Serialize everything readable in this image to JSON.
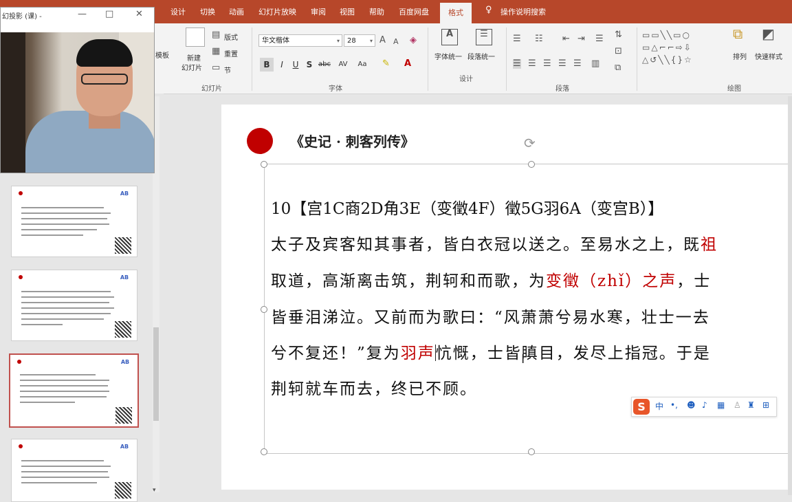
{
  "ribbon_tabs": [
    "设计",
    "切换",
    "动画",
    "幻灯片放映",
    "审阅",
    "视图",
    "帮助",
    "百度网盘",
    "格式"
  ],
  "tell_me": "操作说明搜索",
  "camera_window": {
    "title": "幻投影 (课) -",
    "min": "—",
    "max": "□",
    "close": "✕"
  },
  "slides_group": {
    "new_slide_1": "新建",
    "new_slide_2": "幻灯片",
    "layout": "版式",
    "reset": "重置",
    "section": "节",
    "label": "幻灯片",
    "partial": "模板"
  },
  "font_group": {
    "font_name": "华文楷体",
    "font_size": "28",
    "bold": "B",
    "italic": "I",
    "underline": "U",
    "shadow": "S",
    "strike": "abc",
    "spacing": "AV",
    "case": "Aa",
    "label": "字体"
  },
  "design_group": {
    "text_unify": "字体统一",
    "para_unify": "段落统一",
    "label": "设计"
  },
  "paragraph_group": {
    "label": "段落"
  },
  "drawing_group": {
    "arrange": "排列",
    "quick_styles": "快速样式",
    "label": "绘图"
  },
  "slide_numbers": [
    "",
    "",
    "",
    ""
  ],
  "slide": {
    "title": "《史记 · 刺客列传》",
    "line1": "10【宫1C商2D角3E（变徵4F）徵5G羽6A（变宫B）】",
    "line2a": "太子及宾客知其事者，皆白衣冠以送之。至易水之上，既",
    "line2b": "祖",
    "line3a": "取道，高渐离击筑，荆轲和而歌，为",
    "line3b": "变徵（zhǐ）之声",
    "line3c": "，士",
    "line4": "皆垂泪涕泣。又前而为歌曰：“风萧萧兮易水寒，壮士一去",
    "line5a": "兮不复还！”复为",
    "line5b": "羽声",
    "line5c": "忼慨，士皆瞋目，发尽上指冠。于是",
    "line6": "荆轲就车而去，终已不顾。"
  },
  "ime": {
    "logo": "S",
    "lang": "中",
    "punct": "•,"
  },
  "colors": {
    "accent": "#b7472a",
    "title_dot": "#c00000",
    "highlight_text": "#c00000"
  }
}
